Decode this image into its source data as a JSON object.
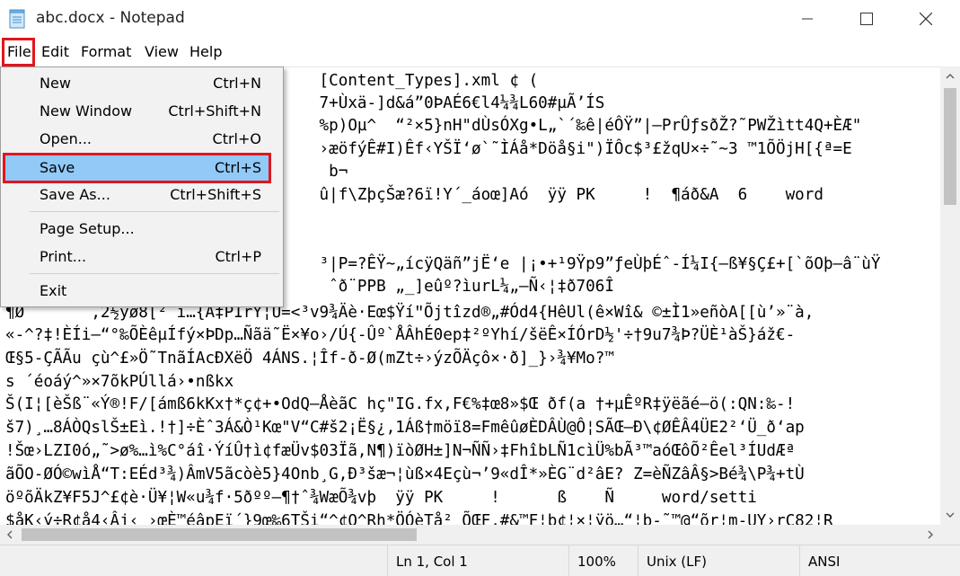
{
  "window": {
    "title": "abc.docx - Notepad"
  },
  "menubar": {
    "file": "File",
    "edit": "Edit",
    "format": "Format",
    "view": "View",
    "help": "Help"
  },
  "file_menu": {
    "items": [
      {
        "label": "New",
        "shortcut": "Ctrl+N"
      },
      {
        "label": "New Window",
        "shortcut": "Ctrl+Shift+N"
      },
      {
        "label": "Open...",
        "shortcut": "Ctrl+O"
      },
      {
        "label": "Save",
        "shortcut": "Ctrl+S"
      },
      {
        "label": "Save As...",
        "shortcut": "Ctrl+Shift+S"
      },
      {
        "label": "Page Setup...",
        "shortcut": ""
      },
      {
        "label": "Print...",
        "shortcut": "Ctrl+P"
      },
      {
        "label": "Exit",
        "shortcut": ""
      }
    ],
    "highlight_color": "#91c9f7",
    "annotation_color": "#e1161d"
  },
  "content": {
    "lines": [
      "                                 [Content_Types].xml ¢ (",
      "                                 7+Ùxä-]d&á”0ÞAÉ6€l4¼¾L60#µÃ’ÍS",
      "                                 %p)Oµ^  “²×5}nH\"dÙsÓXg•L„`´‰ê|éÔŸ”|—PrÛƒsðŽ?˜PWŽìtt4Q+ÈÆ\"",
      "                                 ›æöfýÊ#I)Êf‹YŠÏ‘ø`˜ÌÁå*Döå§i\")ÏÔc$³£žqU×÷˜~3 ™1ÕÖjH[{ª=E",
      "                                  b¬",
      "                                 û|f\\ZþçŠæ?6ï!Y´_áoœ]Aó  ÿÿ PK     !  ¶áð&A  6    word",
      "",
      "",
      "                                 ³|P=?ÊŸ~„ícÿQäñ”jË‘e |¡•+¹9Ÿp9”ƒeÙþÉˆ-Í¼I{—ß¥§Ç£+[`õOþ—â¨ùŸ",
      "                                  ˆð¨PPB „_]eûº?ìurL¼„—Ñ‹¦‡ð706Î",
      "¶Ø       ,2½yø8[² ı…{A‡PÌrY¦Ü=<³v9¾Äè·Eœ$ŸíʺÕjtîzd®„#Ód4{HêUl(ê×Wî& ©±Ì1»eñòA[[ù’»¨à,",
      "«-^?‡!ÈÍi–“°‰ÕÈêµÍfý×ÞDp…Ñãä˜Ë×¥o›/Ú{-Ûº`ÅÂhÉ0ep‡²ºYhí/šëÊ×ÍÓrD½'÷†9u7¾Þ?ÜÈ¹àŠ}áž€-",
      "Œ§5-ÇÃÃu çù^£»Ö˜TnãÍAcÐXëÖ 4ÁNS.¦Îf-ð-Ø(mZt÷›ýzÕÄçô×·ð]_}›¾¥Mo?™",
      "s ´éoáý^»×7õkPÚllá›•nßkx",
      "Š(I¦[èŠß¨«Ý®!F/[ámß6kKx†*ç¢+•OdQ–ÅèãC hç\"IG.fx,F€%‡œ8»$Œ ðf(a †+µÊºR‡ÿëãé–ö(:QN:‰-!",
      "š7)¸…8ÁÒQslŠ±Eì.!†]÷Èˆ3Á&Ò¹Kœ\"V“C#š2¡Ë§¿,1Áß†möï8=FmêûøÈDÂÙ@Ô¦SÃŒ—Ð\\¢ØÊÂ4ÜE2²‘Ü_ð‘ap",
      "!Šœ›LZI0ó„˜>ø%…ì%C°áî·ÝíÛ†ì¢fæÜv$03Ïã,N¶)ïòØH±]N¬ÑÑ›‡FhîbLÑ1cìÜ%bÃ³™aóŒôÕ²Êel³ÍUdÆª",
      "ãÕO-ØÓ©wìÅ“T:EÉd³¾)ÂmV5ãcòè5}4Onb¸G,Ð³šæ¬¦ùß×4Eçù¬’9«dÎ*»ÈG¨d²âE? Z=èÑZâÂ§>Bé¾\\P¾+tÙ",
      "öºõÄkZ¥F5J^£¢è·Ü¥¦W«u¾f·5ðºº—¶†ˆ¾WæÕ¾vþ  ÿÿ PK     !      ß    Ñ     word/setti",
      "$åK‹ý÷R¢å4‹Âj‹ ›œÈ™éâpEï´}9œ‰6TŠi“^¢O^Rh*ÖÓèTå² ÕŒF,#&™F¦b¢¦×¦ÿö…“¦b-˜™@“õr¦m-UY›rÇ82¦R"
    ]
  },
  "statusbar": {
    "position": "Ln 1, Col 1",
    "zoom": "100%",
    "line_ending": "Unix (LF)",
    "encoding": "ANSI"
  }
}
